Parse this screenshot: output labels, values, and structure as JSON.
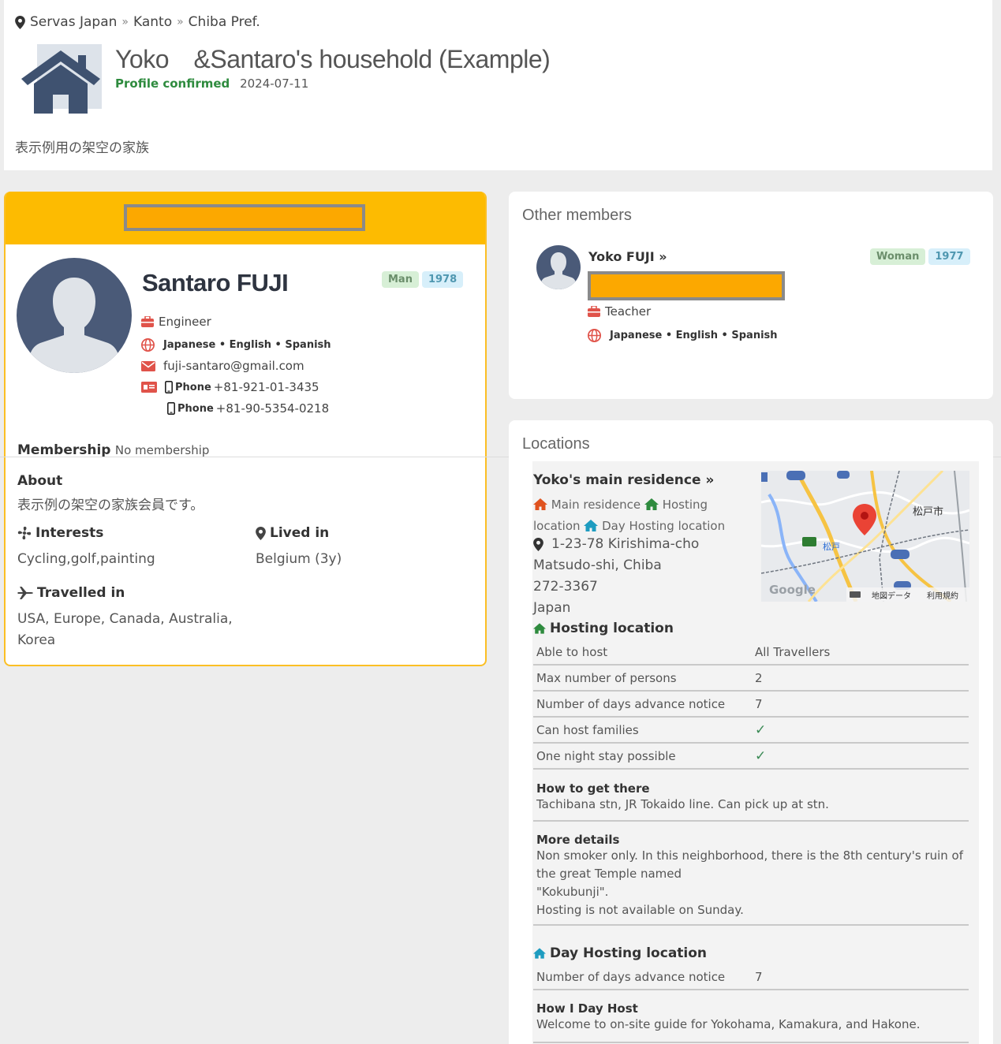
{
  "breadcrumb": {
    "country": "Servas Japan",
    "region": "Kanto",
    "prefecture": "Chiba Pref.",
    "sep": "»"
  },
  "header": {
    "title": "Yoko　&Santaro's household (Example)",
    "confirmed": "Profile confirmed",
    "date": "2024-07-11",
    "description": "表示例用の架空の家族"
  },
  "member": {
    "name": "Santaro FUJI",
    "gender": "Man",
    "birth_year": "1978",
    "occupation": "Engineer",
    "languages": "Japanese • English • Spanish",
    "email": "fuji-santaro@gmail.com",
    "phone_label": "Phone",
    "phone1": "+81-921-01-3435",
    "phone2": "+81-90-5354-0218",
    "membership_label": "Membership",
    "membership_value": "No membership",
    "about_label": "About",
    "about_text": "表示例の架空の家族会員です。",
    "interests_label": "Interests",
    "interests_text": "Cycling,golf,painting",
    "lived_label": "Lived in",
    "lived_text": "Belgium (3y)",
    "travelled_label": "Travelled in",
    "travelled_text": "USA, Europe, Canada, Australia, Korea"
  },
  "other_members": {
    "title": "Other members",
    "name": "Yoko FUJI »",
    "gender": "Woman",
    "birth_year": "1977",
    "occupation": "Teacher",
    "languages": "Japanese • English • Spanish"
  },
  "locations": {
    "title": "Locations",
    "residence_name": "Yoko's main residence »",
    "tag_main": "Main residence",
    "tag_hosting": "Hosting location",
    "tag_day": "Day Hosting location",
    "address_line1": "1-23-78 Kirishima-cho",
    "address_line2": "Matsudo-shi, Chiba",
    "address_line3": "272-3367",
    "address_line4": "Japan",
    "map_city_label": "松戸市",
    "map_station_label": "松戸",
    "map_google": "Google",
    "map_data": "地図データ",
    "map_terms": "利用規約",
    "hosting_heading": "Hosting location",
    "hosting_rows": [
      {
        "k": "Able to host",
        "v": "All Travellers"
      },
      {
        "k": "Max number of persons",
        "v": "2"
      },
      {
        "k": "Number of days advance notice",
        "v": "7"
      },
      {
        "k": "Can host families",
        "v": "✓"
      },
      {
        "k": "One night stay possible",
        "v": "✓"
      }
    ],
    "how_label": "How to get there",
    "how_text": "Tachibana stn, JR Tokaido line. Can pick up at stn.",
    "more_label": "More details",
    "more_text1": "Non smoker only. In this neighborhood, there is the 8th century's ruin of the great Temple named",
    "more_text2": "\"Kokubunji\".",
    "more_text3": "Hosting is not available on Sunday.",
    "day_heading": "Day Hosting location",
    "day_rows": [
      {
        "k": "Number of days advance notice",
        "v": "7"
      }
    ],
    "dayhost_label": "How I Day Host",
    "dayhost_text": "Welcome to on-site guide for Yokohama, Kamakura, and Hakone."
  },
  "colors": {
    "accent_yellow": "#fdbb01",
    "redact_orange": "#fca800",
    "confirmed_green": "#2e8b3e"
  }
}
